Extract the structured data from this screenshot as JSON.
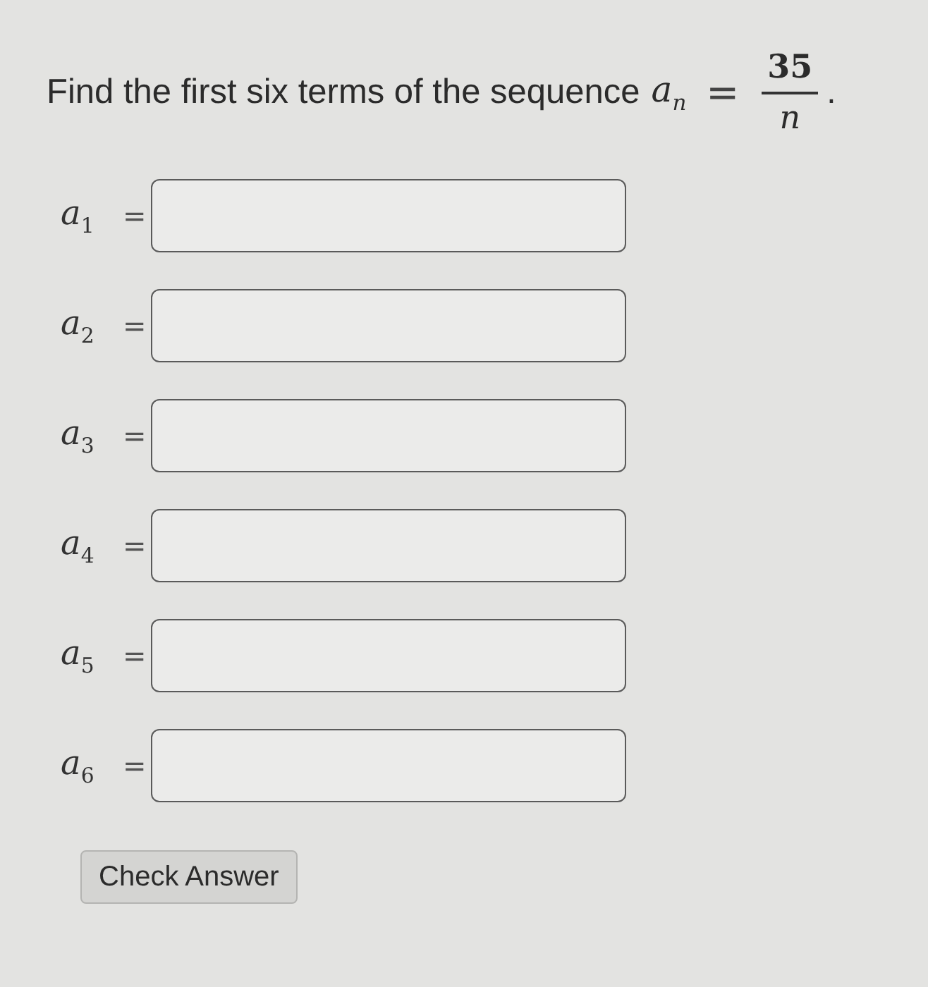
{
  "question": {
    "text": "Find the first six terms of the sequence",
    "formula": {
      "lhs": "*a*$_{n}$",
      "relation": "=",
      "numerator": "35",
      "denominator": "n",
      "end": "."
    }
  },
  "answers": [
    {
      "label": "*a*$_{1}$",
      "relation": "="
    },
    {
      "label": "*a*$_{2}$",
      "relation": "="
    },
    {
      "label": "*a*$_{3}$",
      "relation": "="
    },
    {
      "label": "*a*$_{4}$",
      "relation": "="
    },
    {
      "label": "*a*$_{5}$",
      "relation": "="
    },
    {
      "label": "*a*$_{6}$",
      "relation": "="
    }
  ],
  "button": {
    "label": "Check Answer"
  }
}
